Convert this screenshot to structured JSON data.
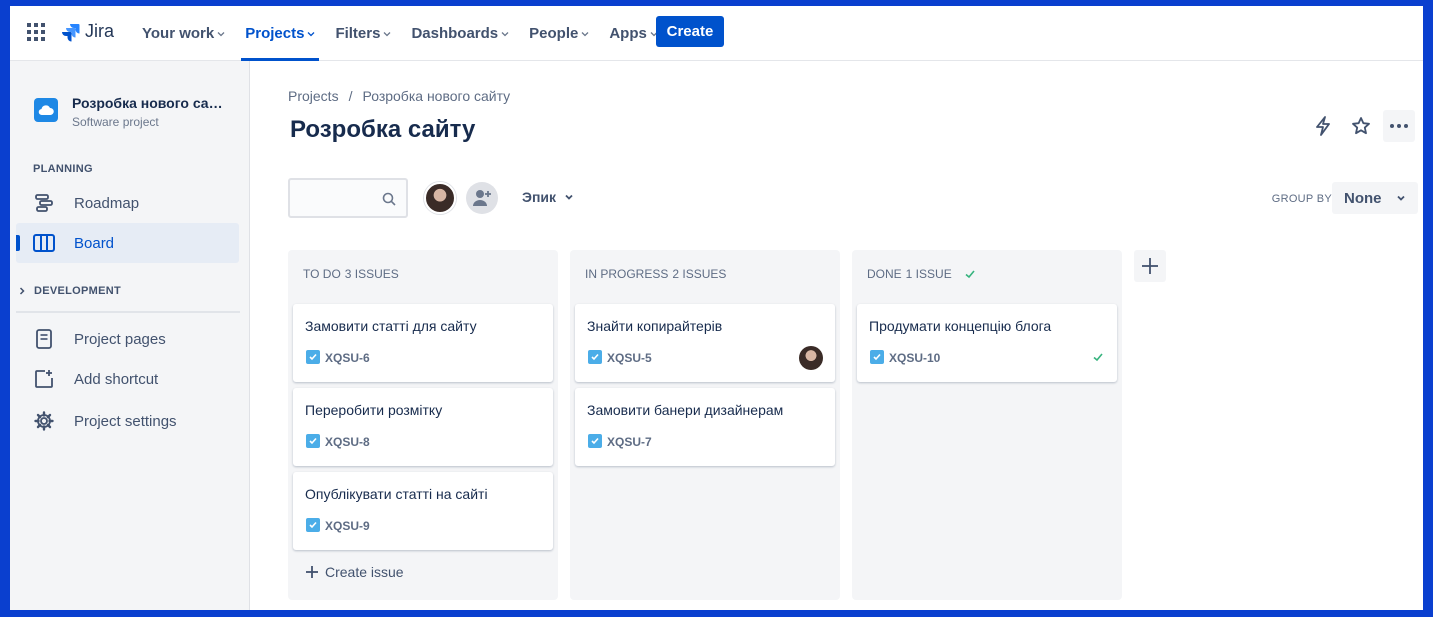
{
  "topnav": {
    "logo_text": "Jira",
    "items": [
      {
        "label": "Your work",
        "active": false
      },
      {
        "label": "Projects",
        "active": true
      },
      {
        "label": "Filters",
        "active": false
      },
      {
        "label": "Dashboards",
        "active": false
      },
      {
        "label": "People",
        "active": false
      },
      {
        "label": "Apps",
        "active": false
      }
    ],
    "create_label": "Create"
  },
  "sidebar": {
    "project_name": "Розробка нового сайту",
    "project_type": "Software project",
    "planning_label": "PLANNING",
    "roadmap_label": "Roadmap",
    "board_label": "Board",
    "development_label": "DEVELOPMENT",
    "project_pages_label": "Project pages",
    "add_shortcut_label": "Add shortcut",
    "project_settings_label": "Project settings"
  },
  "main": {
    "breadcrumb": [
      "Projects",
      "/",
      "Розробка нового сайту"
    ],
    "title": "Розробка сайту",
    "epic_label": "Эпик",
    "group_by_label": "GROUP BY",
    "group_by_value": "None"
  },
  "columns": [
    {
      "name": "TO DO",
      "count": "3 ISSUES",
      "cards": [
        {
          "title": "Замовити статті для сайту",
          "key": "XQSU-6"
        },
        {
          "title": "Переробити розмітку",
          "key": "XQSU-8"
        },
        {
          "title": "Опублікувати статті на сайті",
          "key": "XQSU-9"
        }
      ],
      "create_issue_label": "Create issue"
    },
    {
      "name": "IN PROGRESS",
      "count": "2 ISSUES",
      "cards": [
        {
          "title": "Знайти копирайтерів",
          "key": "XQSU-5"
        },
        {
          "title": "Замовити банери дизайнерам",
          "key": "XQSU-7"
        }
      ]
    },
    {
      "name": "DONE",
      "count": "1 ISSUE",
      "cards": [
        {
          "title": "Продумати концепцію блога",
          "key": "XQSU-10"
        }
      ]
    }
  ],
  "colors": {
    "accent": "#0052cc",
    "task_icon": "#4bade8",
    "done_check": "#36b37e"
  }
}
